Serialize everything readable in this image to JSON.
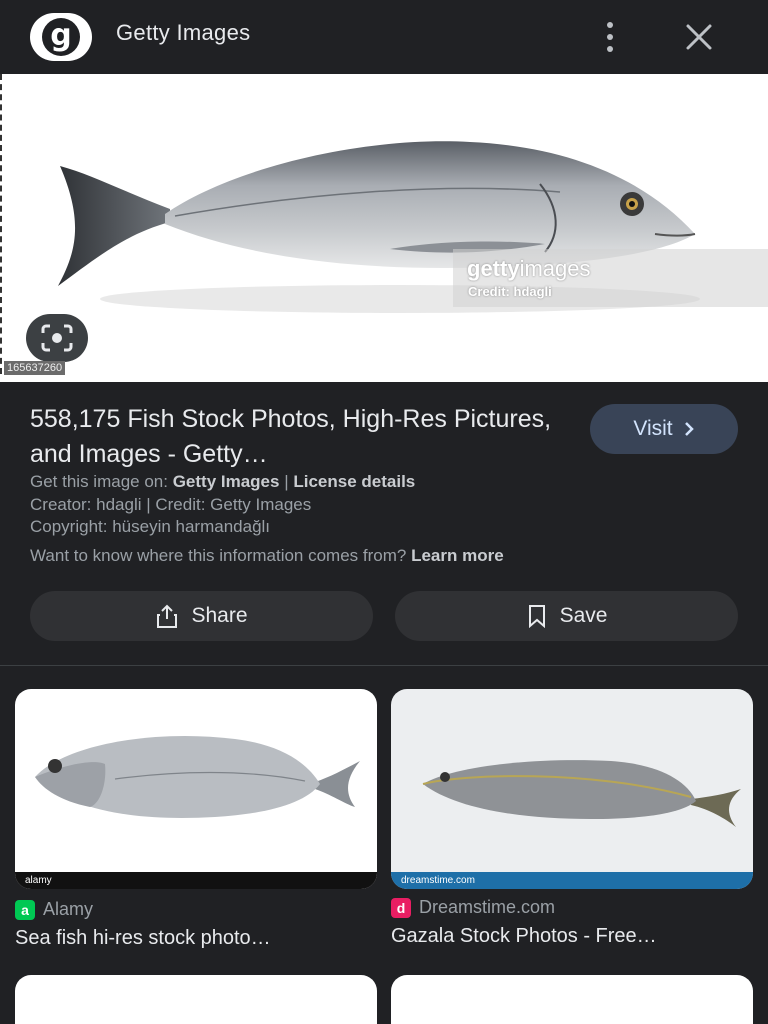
{
  "header": {
    "logo_letter": "g",
    "site_title": "Getty Images"
  },
  "hero": {
    "watermark_logo_bold": "getty",
    "watermark_logo_rest": "images",
    "watermark_credit": "Credit: hdagli",
    "image_id": "165637260"
  },
  "result": {
    "title": "558,175 Fish Stock Photos, High-Res Pictures, and Images - Getty…",
    "visit_label": "Visit",
    "get_image_prefix": "Get this image on:",
    "get_image_source": "Getty Images",
    "separator": "|",
    "license_label": "License details",
    "creator_line": "Creator: hdagli | Credit: Getty Images",
    "copyright_line": "Copyright: hüseyin harmandağlı",
    "info_question": "Want to know where this information comes from?",
    "learn_more": "Learn more"
  },
  "actions": {
    "share_label": "Share",
    "save_label": "Save"
  },
  "related": [
    {
      "source": "Alamy",
      "favicon_letter": "a",
      "favicon_color": "#00c853",
      "caption": "Sea fish hi-res stock photo…",
      "strip_text": "alamy",
      "strip_color": "#111111"
    },
    {
      "source": "Dreamstime.com",
      "favicon_letter": "d",
      "favicon_color": "#e91e63",
      "caption": "Gazala Stock Photos - Free…",
      "strip_text": "dreamstime.com",
      "strip_color": "#1e6fa8"
    }
  ],
  "colors": {
    "background": "#202124",
    "button": "#303134",
    "visit_button": "#394457"
  }
}
